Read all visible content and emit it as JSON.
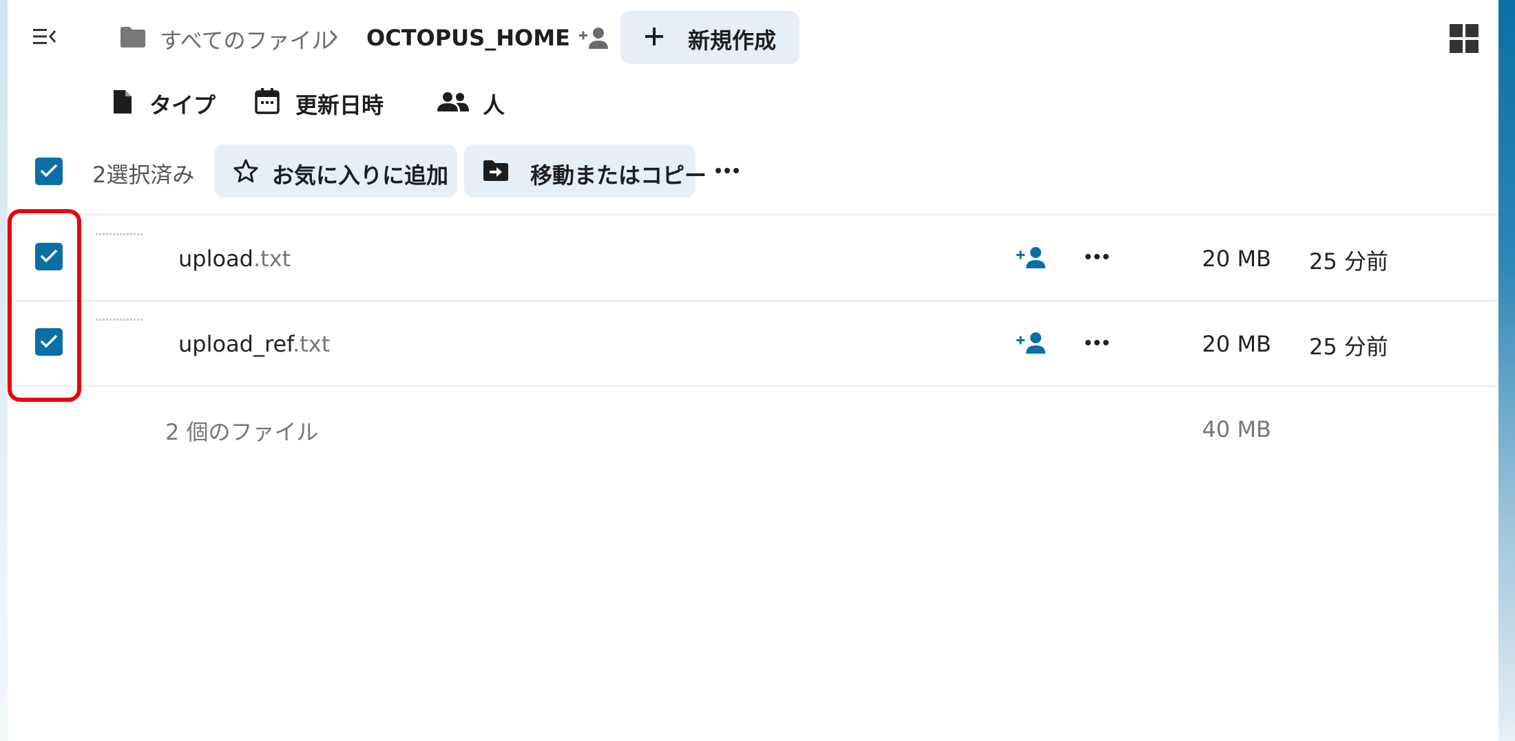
{
  "header": {
    "breadcrumb_root": "すべてのファイル",
    "breadcrumb_current": "OCTOPUS_HOME",
    "new_button_label": "新規作成"
  },
  "filters": {
    "type_label": "タイプ",
    "modified_label": "更新日時",
    "people_label": "人"
  },
  "selection": {
    "count_label": "2選択済み",
    "favorite_label": "お気に入りに追加",
    "move_copy_label": "移動またはコピー"
  },
  "files": [
    {
      "name": "upload",
      "ext": ".txt",
      "size": "20 MB",
      "modified": "25 分前",
      "checked": true
    },
    {
      "name": "upload_ref",
      "ext": ".txt",
      "size": "20 MB",
      "modified": "25 分前",
      "checked": true
    }
  ],
  "summary": {
    "count_label": "2 個のファイル",
    "total_size": "40 MB"
  },
  "icons": {
    "sidebar_toggle": "menu-collapse-icon",
    "folder": "folder-icon",
    "chevron": "chevron-right-icon",
    "share": "account-plus-icon",
    "plus": "plus-icon",
    "grid": "grid-view-icon",
    "type": "file-icon",
    "calendar": "calendar-icon",
    "people": "people-icon",
    "star": "star-outline-icon",
    "move": "folder-move-icon",
    "more": "dots-horizontal-icon"
  },
  "colors": {
    "accent": "#0b6fa6",
    "button_bg": "#e6eef6",
    "highlight": "#e8000e"
  }
}
